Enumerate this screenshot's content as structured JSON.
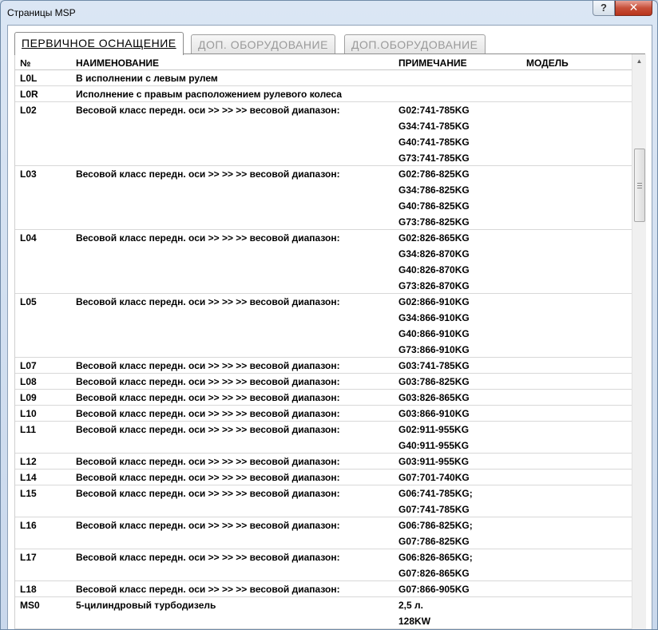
{
  "window": {
    "title": "Страницы MSP",
    "help_label": "?",
    "close_label": "✕"
  },
  "tabs": [
    {
      "label": "ПЕРВИЧНОЕ ОСНАЩЕНИЕ",
      "active": true
    },
    {
      "label": "ДОП. ОБОРУДОВАНИЕ",
      "active": false
    },
    {
      "label": "ДОП.ОБОРУДОВАНИЕ",
      "active": false
    }
  ],
  "columns": {
    "no": "№",
    "name": "НАИМЕНОВАНИЕ",
    "note": "ПРИМЕЧАНИЕ",
    "model": "МОДЕЛЬ"
  },
  "scrollbar": {
    "up_arrow": "▲"
  },
  "rows": [
    {
      "no": "L0L",
      "name": "В исполнении с левым рулем",
      "notes": []
    },
    {
      "no": "L0R",
      "name": "Исполнение с правым расположением рулевого колеса",
      "notes": []
    },
    {
      "no": "L02",
      "name": "Весовой класс передн. оси >> >> >> весовой диапазон:",
      "notes": [
        "G02:741-785KG",
        "G34:741-785KG",
        "G40:741-785KG",
        "G73:741-785KG"
      ]
    },
    {
      "no": "L03",
      "name": "Весовой класс передн. оси >> >> >> весовой диапазон:",
      "notes": [
        "G02:786-825KG",
        "G34:786-825KG",
        "G40:786-825KG",
        "G73:786-825KG"
      ]
    },
    {
      "no": "L04",
      "name": "Весовой класс передн. оси >> >> >> весовой диапазон:",
      "notes": [
        "G02:826-865KG",
        "G34:826-870KG",
        "G40:826-870KG",
        "G73:826-870KG"
      ]
    },
    {
      "no": "L05",
      "name": "Весовой класс передн. оси >> >> >> весовой диапазон:",
      "notes": [
        "G02:866-910KG",
        "G34:866-910KG",
        "G40:866-910KG",
        "G73:866-910KG"
      ]
    },
    {
      "no": "L07",
      "name": "Весовой класс передн. оси >> >> >> весовой диапазон:",
      "notes": [
        "G03:741-785KG"
      ]
    },
    {
      "no": "L08",
      "name": "Весовой класс передн. оси >> >> >> весовой диапазон:",
      "notes": [
        "G03:786-825KG"
      ]
    },
    {
      "no": "L09",
      "name": "Весовой класс передн. оси >> >> >> весовой диапазон:",
      "notes": [
        "G03:826-865KG"
      ]
    },
    {
      "no": "L10",
      "name": "Весовой класс передн. оси >> >> >> весовой диапазон:",
      "notes": [
        "G03:866-910KG"
      ]
    },
    {
      "no": "L11",
      "name": "Весовой класс передн. оси >> >> >> весовой диапазон:",
      "notes": [
        "G02:911-955KG",
        "G40:911-955KG"
      ]
    },
    {
      "no": "L12",
      "name": "Весовой класс передн. оси >> >> >> весовой диапазон:",
      "notes": [
        "G03:911-955KG"
      ]
    },
    {
      "no": "L14",
      "name": "Весовой класс передн. оси >> >> >> весовой диапазон:",
      "notes": [
        "G07:701-740KG"
      ]
    },
    {
      "no": "L15",
      "name": "Весовой класс передн. оси >> >> >> весовой диапазон:",
      "notes": [
        "G06:741-785KG;",
        "G07:741-785KG"
      ]
    },
    {
      "no": "L16",
      "name": "Весовой класс передн. оси >> >> >> весовой диапазон:",
      "notes": [
        "G06:786-825KG;",
        "G07:786-825KG"
      ]
    },
    {
      "no": "L17",
      "name": "Весовой класс передн. оси >> >> >> весовой диапазон:",
      "notes": [
        "G06:826-865KG;",
        "G07:826-865KG"
      ]
    },
    {
      "no": "L18",
      "name": "Весовой класс передн. оси >> >> >> весовой диапазон:",
      "notes": [
        "G07:866-905KG"
      ]
    },
    {
      "no": "MS0",
      "name": "5-цилиндровый турбодизель",
      "notes": [
        "2,5 л.",
        "128KW"
      ]
    }
  ]
}
